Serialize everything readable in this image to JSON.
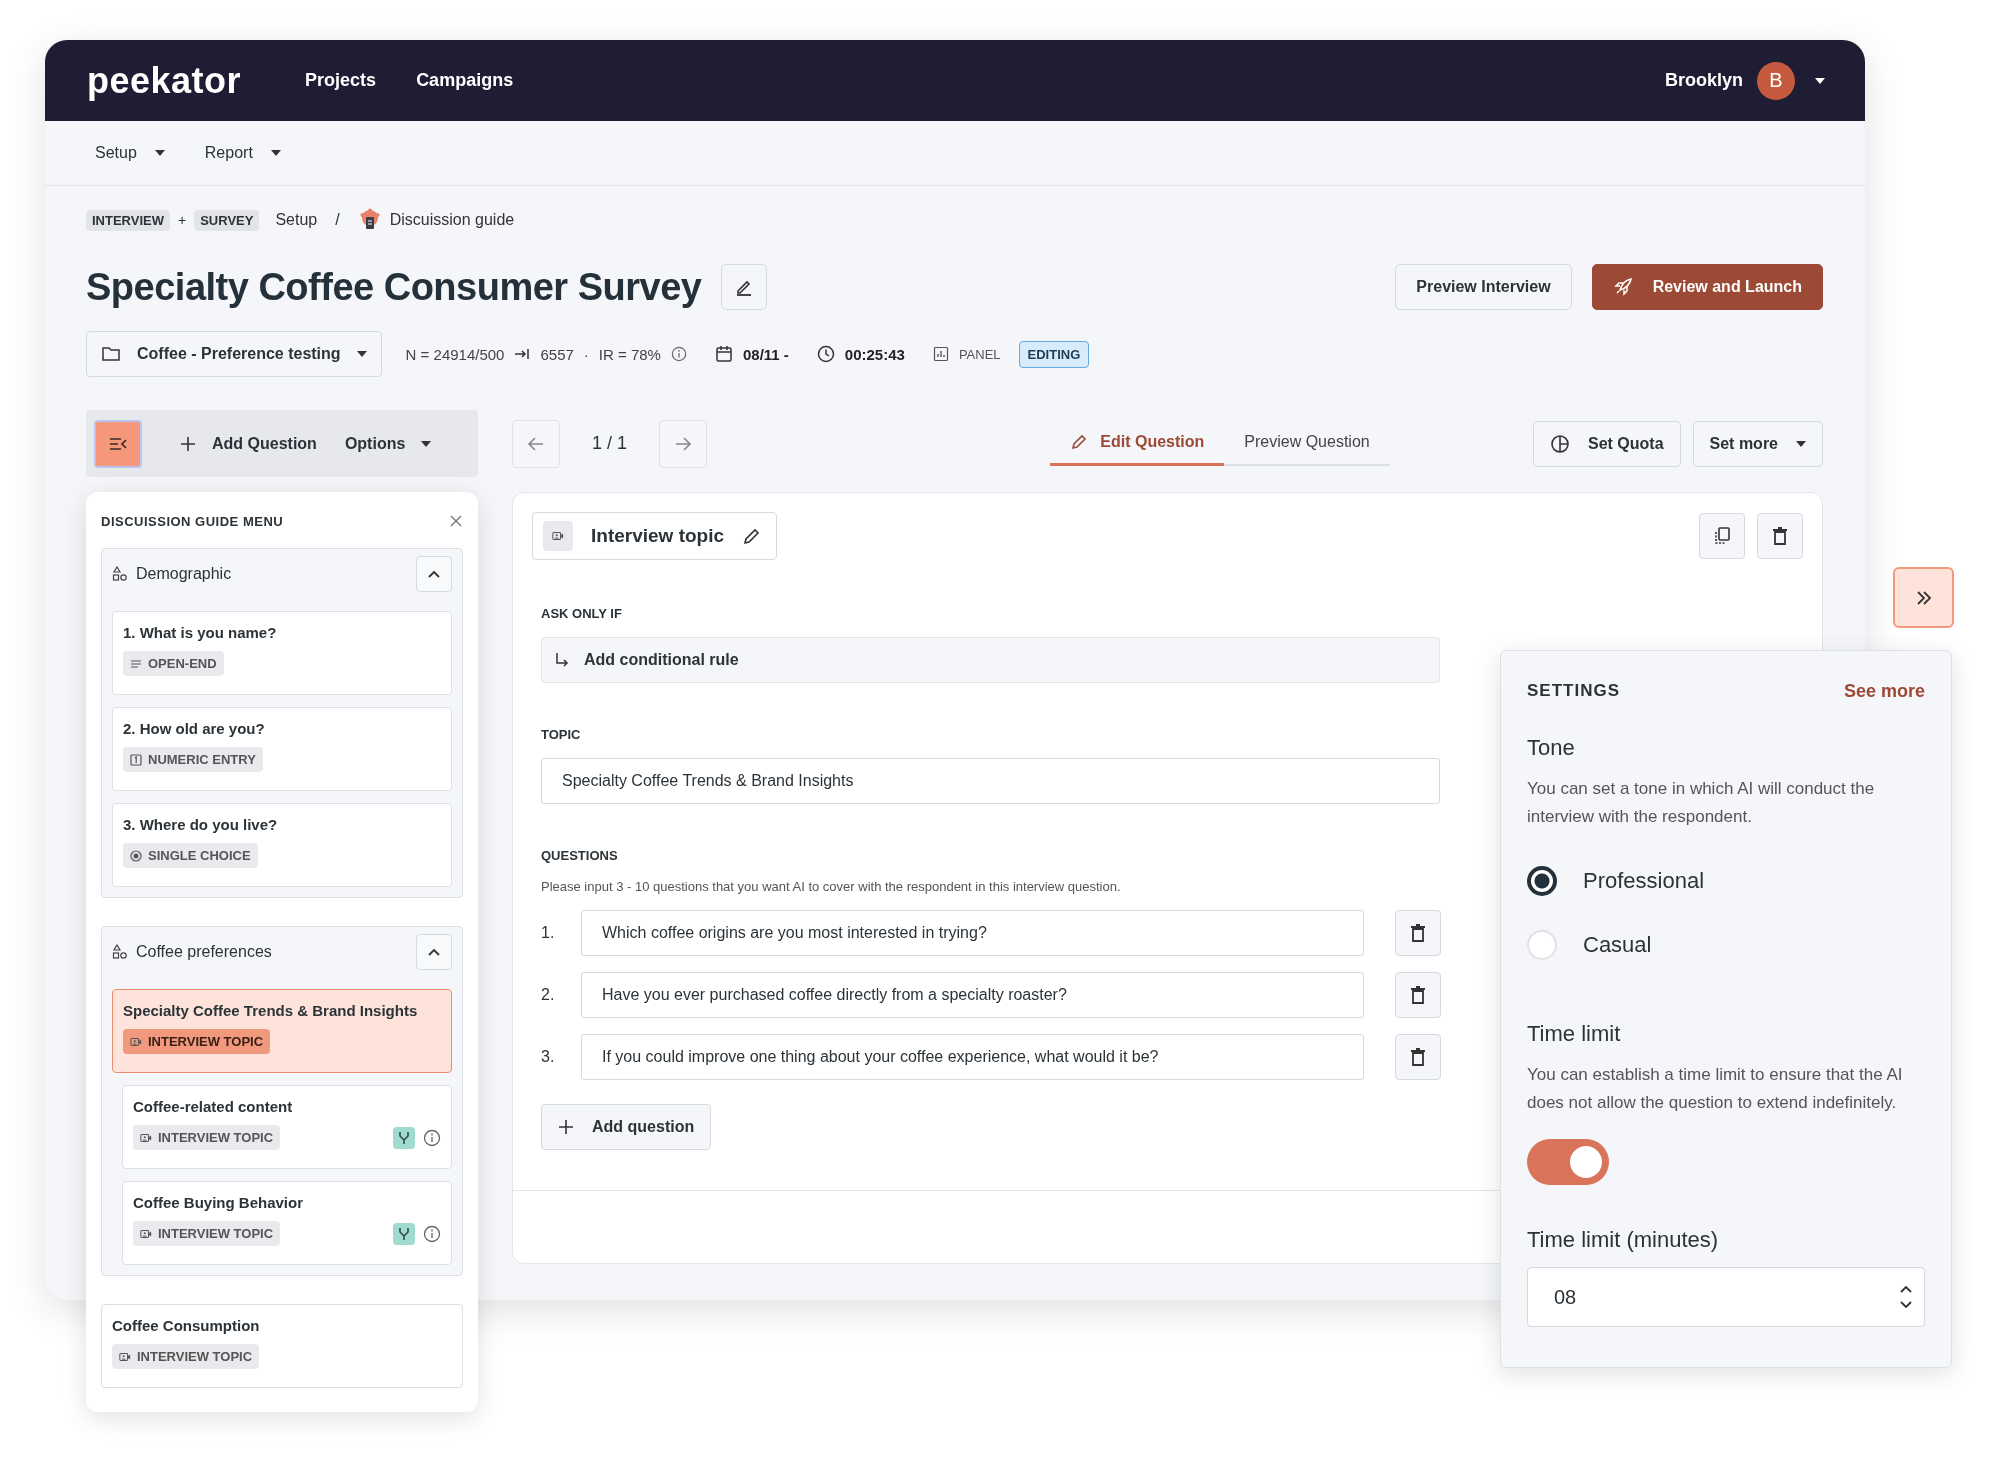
{
  "header": {
    "logo": "peekator",
    "nav": [
      {
        "label": "Projects"
      },
      {
        "label": "Campaigns"
      }
    ],
    "user": {
      "name": "Brooklyn",
      "initial": "B"
    }
  },
  "subnav": [
    {
      "label": "Setup"
    },
    {
      "label": "Report"
    }
  ],
  "breadcrumb": {
    "tags": [
      "INTERVIEW",
      "SURVEY"
    ],
    "joiner": "+",
    "items": [
      "Setup"
    ],
    "separator": "/",
    "current": "Discuission guide"
  },
  "title": "Specialty Coffee Consumer Survey",
  "actions": [
    {
      "label": "Preview Interview",
      "kind": "secondary"
    },
    {
      "label": "Review and Launch",
      "kind": "primary"
    }
  ],
  "meta": {
    "project": "Coffee - Preference testing",
    "sample": "N = 24914/500",
    "completes": "6557",
    "dot": "·",
    "ir": "IR = 78%",
    "date": "08/11 -",
    "duration": "00:25:43",
    "panel": "PANEL",
    "status": "EDITING"
  },
  "toolbar": {
    "add": "Add Question",
    "options": "Options"
  },
  "sidebar": {
    "title": "DISCUISSION GUIDE MENU",
    "sections": [
      {
        "name": "Demographic",
        "expanded": true,
        "items": [
          {
            "title": "1. What is you name?",
            "tag": "OPEN-END",
            "kind": "open-end",
            "selected": false
          },
          {
            "title": "2. How old are you?",
            "tag": "NUMERIC ENTRY",
            "kind": "numeric",
            "selected": false
          },
          {
            "title": "3. Where do you live?",
            "tag": "SINGLE CHOICE",
            "kind": "single-choice",
            "selected": false
          }
        ]
      },
      {
        "name": "Coffee preferences",
        "expanded": true,
        "items": [
          {
            "title": "Specialty Coffee Trends & Brand Insights",
            "tag": "INTERVIEW TOPIC",
            "kind": "interview",
            "selected": true,
            "children": [
              {
                "title": "Coffee-related content",
                "tag": "INTERVIEW TOPIC",
                "kind": "interview",
                "selected": false,
                "branch": true
              },
              {
                "title": "Coffee Buying Behavior",
                "tag": "INTERVIEW TOPIC",
                "kind": "interview",
                "selected": false,
                "branch": true
              }
            ]
          }
        ]
      }
    ],
    "loose": [
      {
        "title": "Coffee Consumption",
        "tag": "INTERVIEW TOPIC",
        "kind": "interview",
        "selected": false
      }
    ]
  },
  "pager": "1 / 1",
  "question_tabs": [
    {
      "label": "Edit Question",
      "selected": true
    },
    {
      "label": "Preview Question",
      "selected": false
    }
  ],
  "quota": {
    "set_quota": "Set Quota",
    "set_more": "Set more"
  },
  "card": {
    "type": "Interview topic",
    "ask_label": "ASK ONLY IF",
    "ask_action": "Add conditional rule",
    "topic_label": "TOPIC",
    "topic": "Specialty Coffee Trends & Brand Insights",
    "questions_label": "QUESTIONS",
    "questions_hint": "Please input 3 - 10 questions that you want AI to cover with the respondent in this interview question.",
    "questions": [
      {
        "number": "1.",
        "text": "Which coffee origins are you most interested in trying?"
      },
      {
        "number": "2.",
        "text": "Have you ever purchased coffee directly from a specialty roaster?"
      },
      {
        "number": "3.",
        "text": "If you could improve one thing about your coffee experience, what would it be?"
      }
    ],
    "add_question": "Add question"
  },
  "settings": {
    "title": "SETTINGS",
    "link": "See more",
    "tone_heading": "Tone",
    "tone_desc": "You can set a tone in which AI will conduct the interview with the respondent.",
    "tones": [
      {
        "label": "Professional",
        "selected": true
      },
      {
        "label": "Casual",
        "selected": false
      }
    ],
    "time_heading": "Time limit",
    "time_desc": "You can establish a time limit to ensure that the AI does not allow the question to extend indefinitely.",
    "time_limit_on": true,
    "minutes_label": "Time limit (minutes)",
    "minutes": "08"
  }
}
